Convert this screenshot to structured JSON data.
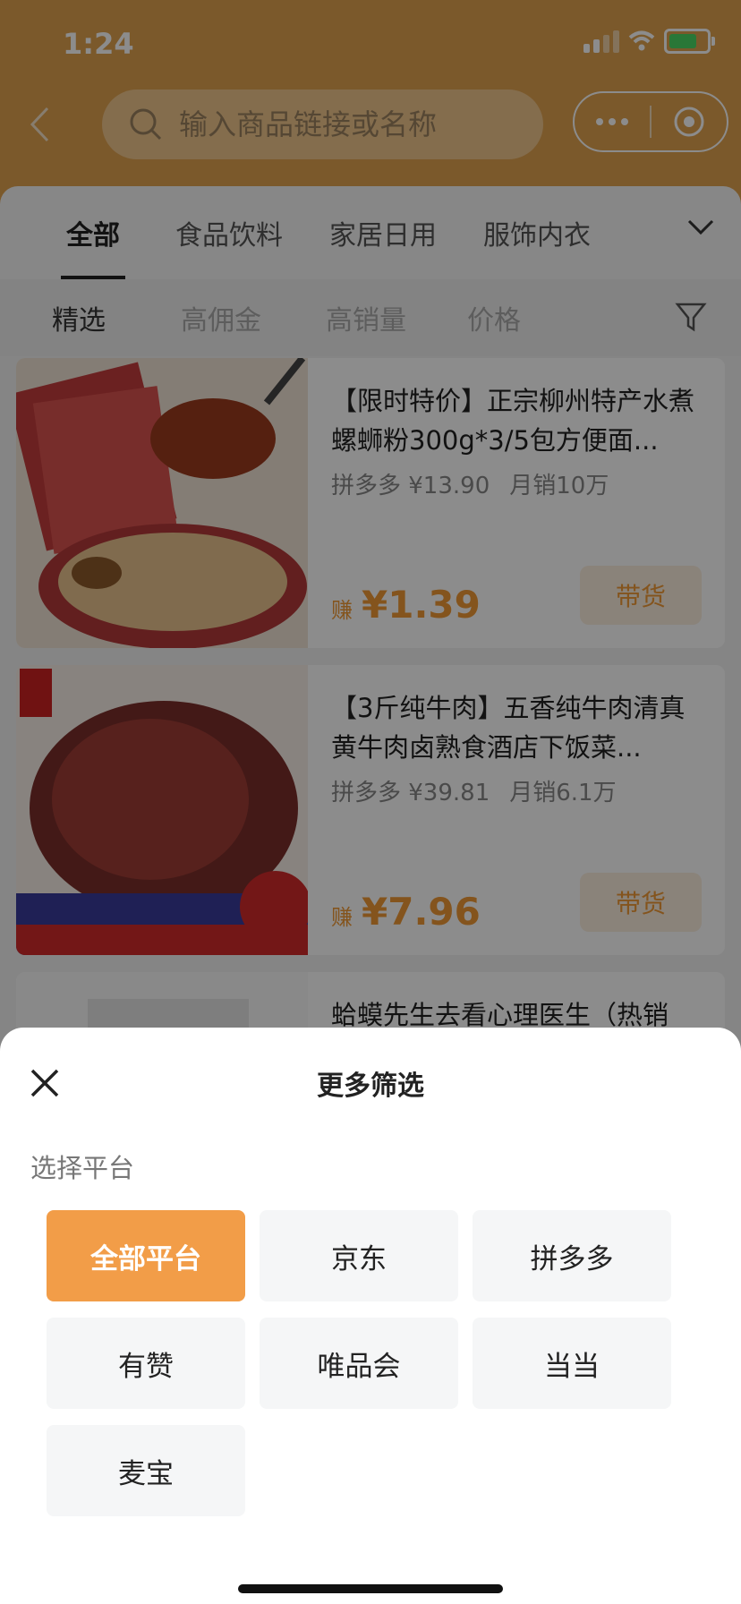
{
  "status": {
    "time": "1:24"
  },
  "search": {
    "placeholder": "输入商品链接或名称"
  },
  "tabs": [
    {
      "label": "全部"
    },
    {
      "label": "食品饮料"
    },
    {
      "label": "家居日用"
    },
    {
      "label": "服饰内衣"
    }
  ],
  "filters": [
    {
      "label": "精选"
    },
    {
      "label": "高佣金"
    },
    {
      "label": "高销量"
    },
    {
      "label": "价格"
    }
  ],
  "products": [
    {
      "title": "【限时特价】正宗柳州特产水煮螺蛳粉300g*3/5包方便面...",
      "platform": "拼多多 ¥13.90",
      "sales": "月销10万",
      "earn_label": "赚",
      "earn": "¥1.39",
      "button": "带货"
    },
    {
      "title": "【3斤纯牛肉】五香纯牛肉清真黄牛肉卤熟食酒店下饭菜...",
      "platform": "拼多多 ¥39.81",
      "sales": "月销6.1万",
      "earn_label": "赚",
      "earn": "¥7.96",
      "button": "带货"
    },
    {
      "title": "蛤蟆先生去看心理医生（热销"
    }
  ],
  "sheet": {
    "title": "更多筛选",
    "section_label": "选择平台",
    "platforms": [
      {
        "label": "全部平台",
        "selected": true
      },
      {
        "label": "京东",
        "selected": false
      },
      {
        "label": "拼多多",
        "selected": false
      },
      {
        "label": "有赞",
        "selected": false
      },
      {
        "label": "唯品会",
        "selected": false
      },
      {
        "label": "当当",
        "selected": false
      },
      {
        "label": "麦宝",
        "selected": false
      }
    ]
  },
  "colors": {
    "header": "#e0a24f",
    "accent": "#f29d48",
    "earn": "#f09a36"
  }
}
